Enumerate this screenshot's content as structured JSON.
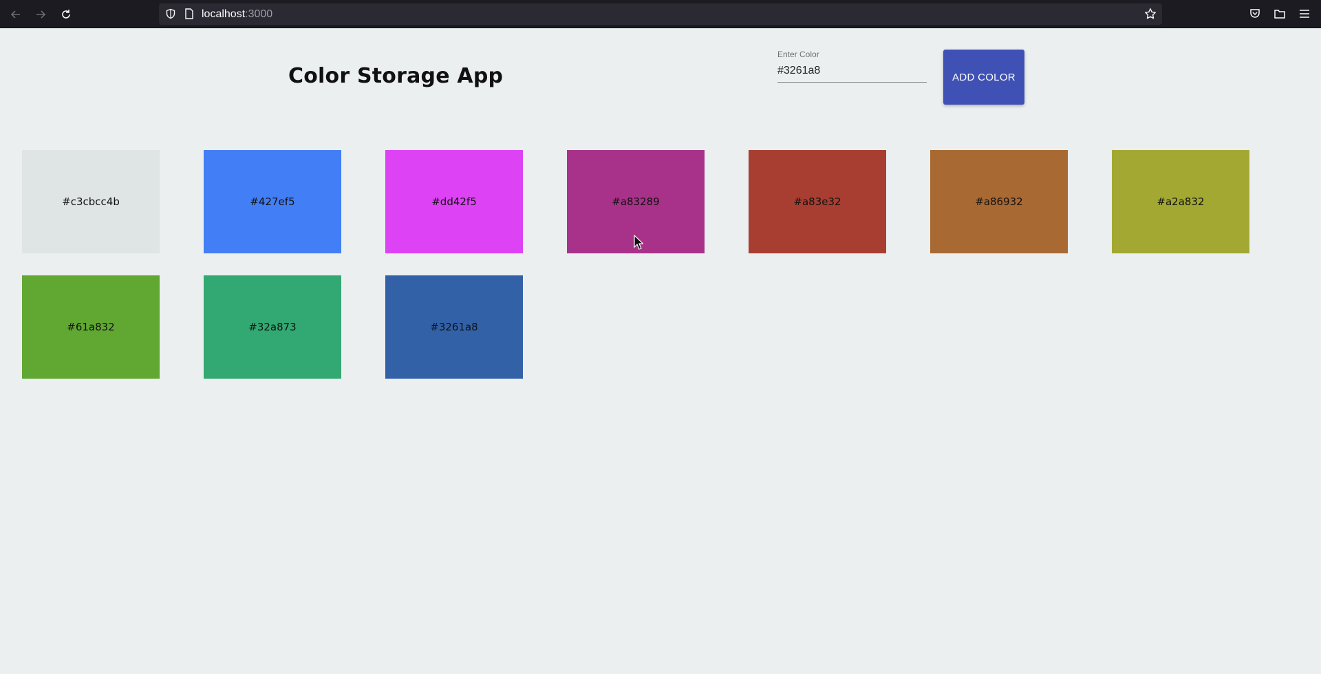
{
  "browser": {
    "url_host": "localhost",
    "url_port": ":3000"
  },
  "app": {
    "title": "Color Storage App",
    "input_label": "Enter Color",
    "input_value": "#3261a8",
    "add_button_label": "ADD COLOR"
  },
  "colors": [
    {
      "hex": "#c3cbcc4b",
      "swatch": "#dfe4e5"
    },
    {
      "hex": "#427ef5",
      "swatch": "#427ef5"
    },
    {
      "hex": "#dd42f5",
      "swatch": "#dd42f5"
    },
    {
      "hex": "#a83289",
      "swatch": "#a83289"
    },
    {
      "hex": "#a83e32",
      "swatch": "#a83e32"
    },
    {
      "hex": "#a86932",
      "swatch": "#a86932"
    },
    {
      "hex": "#a2a832",
      "swatch": "#a2a832"
    },
    {
      "hex": "#61a832",
      "swatch": "#61a832"
    },
    {
      "hex": "#32a873",
      "swatch": "#32a873"
    },
    {
      "hex": "#3261a8",
      "swatch": "#3261a8"
    }
  ],
  "icons": {
    "back": "back-arrow-icon",
    "forward": "forward-arrow-icon",
    "reload": "reload-icon",
    "shield": "shield-icon",
    "page": "page-icon",
    "star": "star-icon",
    "pocket": "pocket-icon",
    "library": "library-icon",
    "menu": "hamburger-menu-icon"
  }
}
